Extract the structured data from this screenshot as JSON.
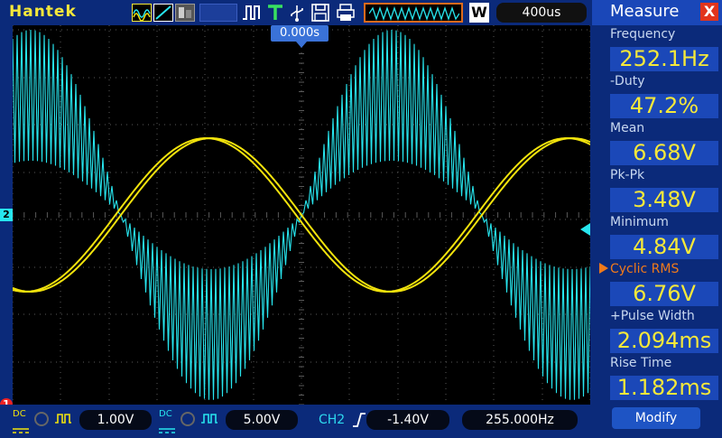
{
  "brand": "Hantek",
  "timebase": "400us",
  "w_label": "W",
  "trigger_position": "0.000s",
  "markers": {
    "ch2": "2",
    "ch1": "1"
  },
  "bottom": {
    "ch1_coupling": "DC",
    "ch1_volts_div": "1.00V",
    "ch2_coupling": "DC",
    "ch2_volts_div": "5.00V",
    "trigger_source": "CH2",
    "trigger_level": "-1.40V",
    "trigger_frequency": "255.000Hz"
  },
  "measure": {
    "title": "Measure",
    "close": "X",
    "items": [
      {
        "label": "Frequency",
        "value": "252.1Hz"
      },
      {
        "label": "-Duty",
        "value": "47.2%"
      },
      {
        "label": "Mean",
        "value": "6.68V"
      },
      {
        "label": "Pk-Pk",
        "value": "3.48V"
      },
      {
        "label": "Minimum",
        "value": "4.84V"
      },
      {
        "label": "Cyclic RMS",
        "value": "6.76V",
        "selected": true
      },
      {
        "label": "+Pulse Width",
        "value": "2.094ms"
      },
      {
        "label": "Rise Time",
        "value": "1.182ms"
      }
    ],
    "modify": "Modify"
  },
  "colors": {
    "background": "#0b2a7a",
    "ch1": "#f2e30c",
    "ch2": "#27e5ee",
    "grid": "#5a5a5a",
    "value_text": "#f5e83a",
    "close_button": "#e2341c"
  }
}
